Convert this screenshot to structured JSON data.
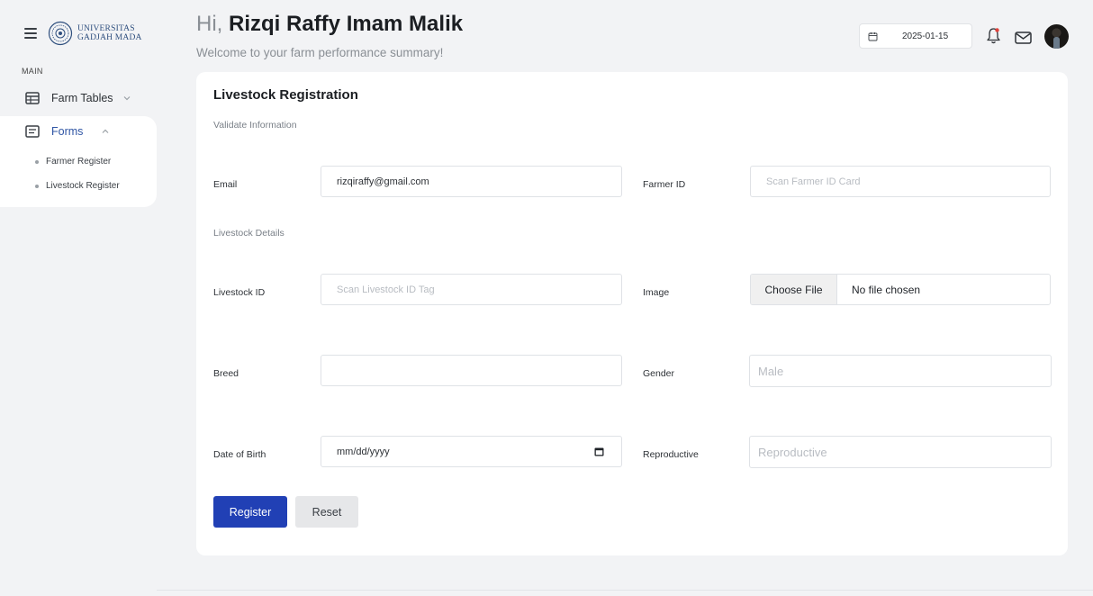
{
  "sidebar": {
    "logo_line1": "UNIVERSITAS",
    "logo_line2": "GADJAH MADA",
    "section_label": "MAIN",
    "items": [
      {
        "label": "Farm Tables",
        "icon": "table-icon",
        "expanded": false
      },
      {
        "label": "Forms",
        "icon": "form-icon",
        "expanded": true,
        "active": true,
        "children": [
          {
            "label": "Farmer Register"
          },
          {
            "label": "Livestock Register"
          }
        ]
      }
    ]
  },
  "header": {
    "greeting_prefix": "Hi,",
    "user_name": "Rizqi Raffy Imam Malik",
    "subtitle": "Welcome to your farm performance summary!",
    "date": "2025-01-15"
  },
  "form": {
    "title": "Livestock Registration",
    "section_validate": "Validate Information",
    "section_details": "Livestock Details",
    "fields": {
      "email": {
        "label": "Email",
        "value": "rizqiraffy@gmail.com"
      },
      "farmer_id": {
        "label": "Farmer ID",
        "placeholder": "Scan Farmer ID Card"
      },
      "livestock_id": {
        "label": "Livestock ID",
        "placeholder": "Scan Livestock ID Tag"
      },
      "image": {
        "label": "Image",
        "button": "Choose File",
        "status": "No file chosen"
      },
      "breed": {
        "label": "Breed",
        "value": ""
      },
      "gender": {
        "label": "Gender",
        "placeholder": "Male"
      },
      "dob": {
        "label": "Date of Birth",
        "value": "mm/dd/yyyy"
      },
      "reproductive": {
        "label": "Reproductive",
        "placeholder": "Reproductive"
      }
    },
    "register_label": "Register",
    "reset_label": "Reset"
  },
  "colors": {
    "primary": "#2140b5",
    "active_nav": "#2f55a4",
    "background": "#f2f3f5"
  }
}
